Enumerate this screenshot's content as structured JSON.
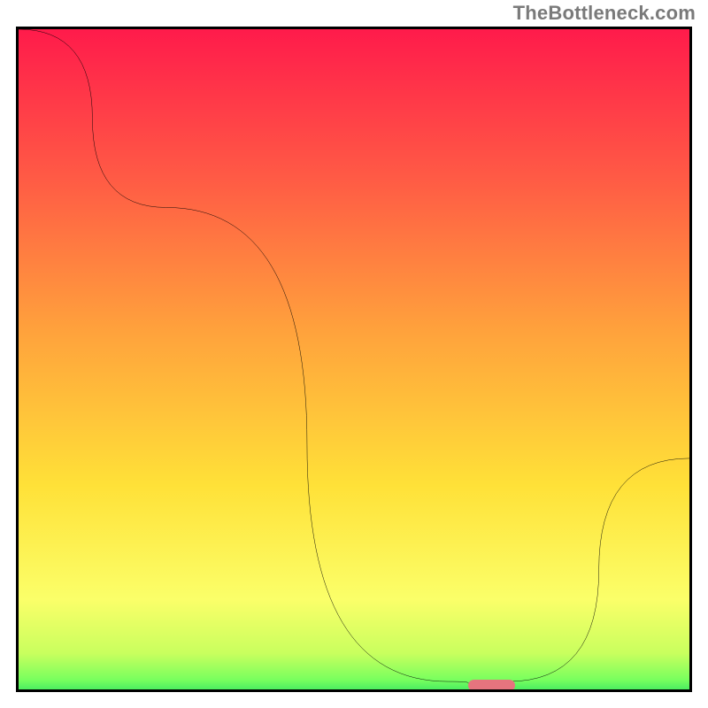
{
  "watermark": "TheBottleneck.com",
  "chart_data": {
    "type": "line",
    "title": "",
    "xlabel": "",
    "ylabel": "",
    "xlim": [
      0,
      100
    ],
    "ylim": [
      0,
      100
    ],
    "series": [
      {
        "name": "bottleneck-curve",
        "x": [
          0,
          22,
          64,
          70,
          73,
          100
        ],
        "values": [
          100,
          73,
          1.2,
          0.8,
          1.2,
          35
        ]
      }
    ],
    "marker": {
      "x_start": 67,
      "x_end": 74,
      "y": 0.7
    },
    "gradient_stops": [
      {
        "pct": 0,
        "color": "#ff1b4b"
      },
      {
        "pct": 22,
        "color": "#ff5a45"
      },
      {
        "pct": 45,
        "color": "#ffa23c"
      },
      {
        "pct": 68,
        "color": "#ffe138"
      },
      {
        "pct": 85,
        "color": "#fbff69"
      },
      {
        "pct": 93,
        "color": "#c9ff5e"
      },
      {
        "pct": 97,
        "color": "#78ff5e"
      },
      {
        "pct": 100,
        "color": "#1bdc64"
      }
    ]
  }
}
